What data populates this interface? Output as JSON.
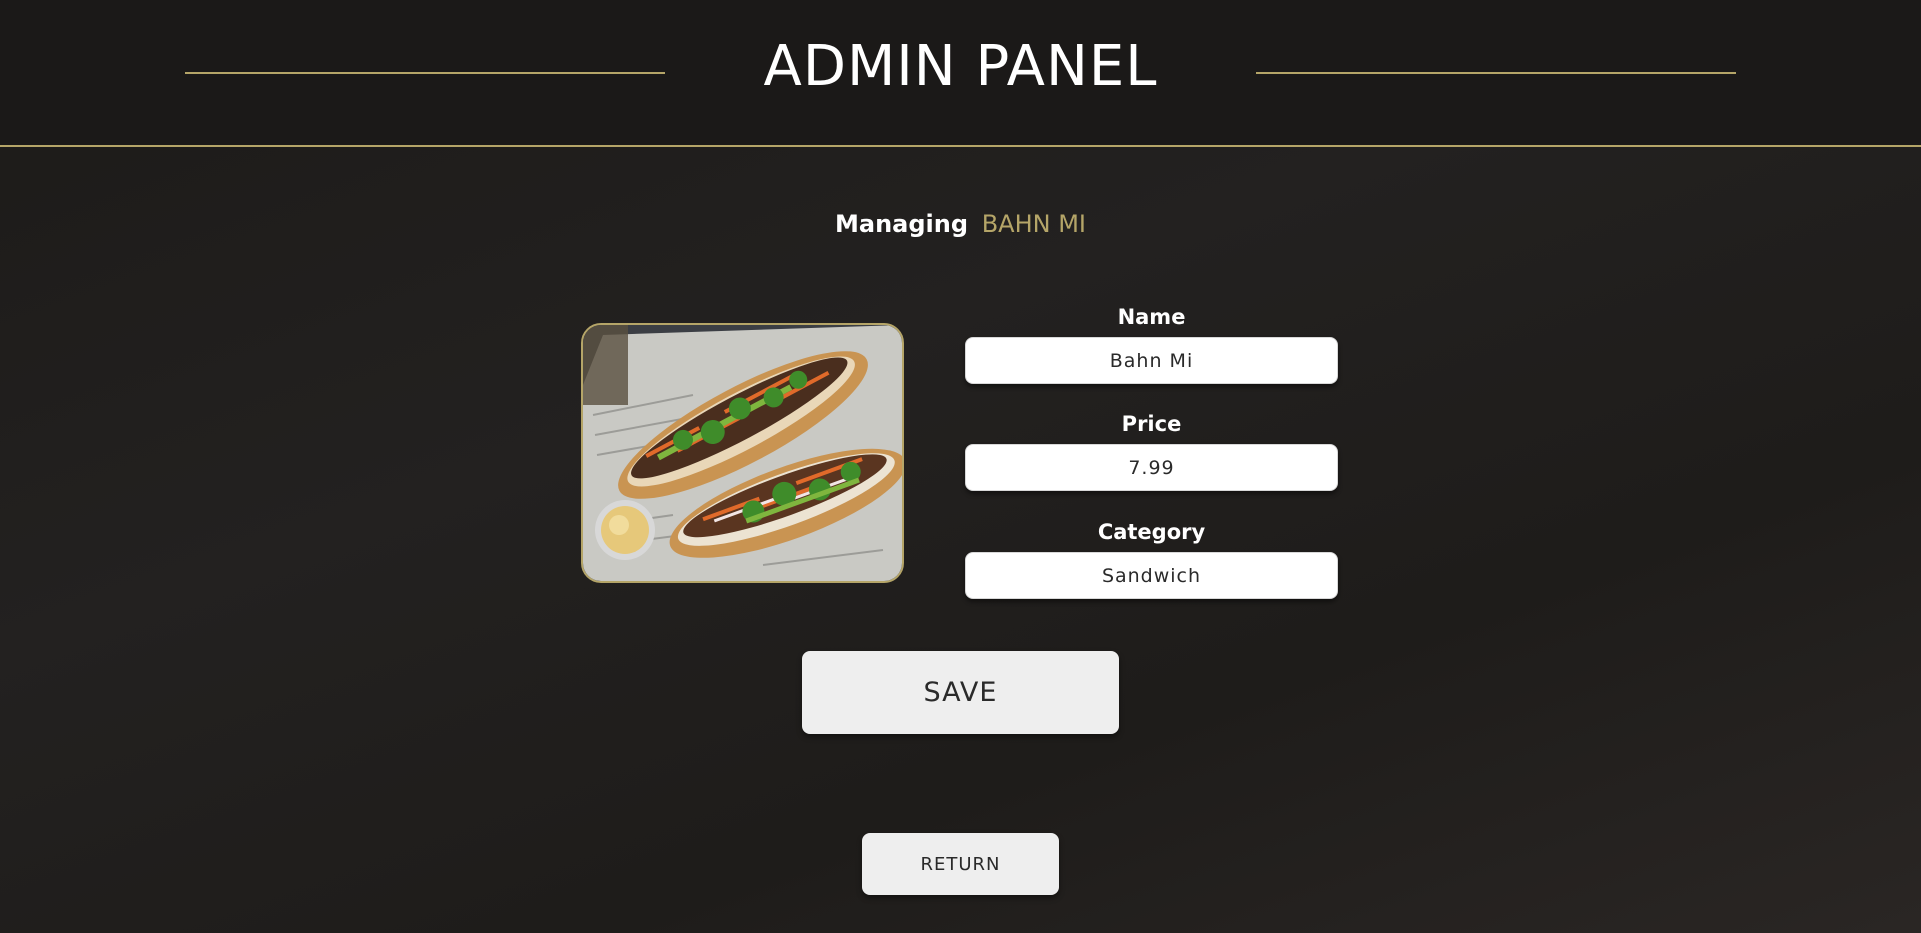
{
  "header": {
    "title": "ADMIN PANEL"
  },
  "managing": {
    "prefix": "Managing",
    "item_name": "BAHN MI"
  },
  "image": {
    "description_icon": "sandwich-photo"
  },
  "form": {
    "name_label": "Name",
    "name_value": "Bahn Mi",
    "price_label": "Price",
    "price_value": "7.99",
    "category_label": "Category",
    "category_value": "Sandwich"
  },
  "actions": {
    "save_label": "SAVE",
    "return_label": "RETURN"
  },
  "colors": {
    "accent": "#b5a568",
    "background": "#1e1c1a",
    "button": "#eeeeee"
  }
}
